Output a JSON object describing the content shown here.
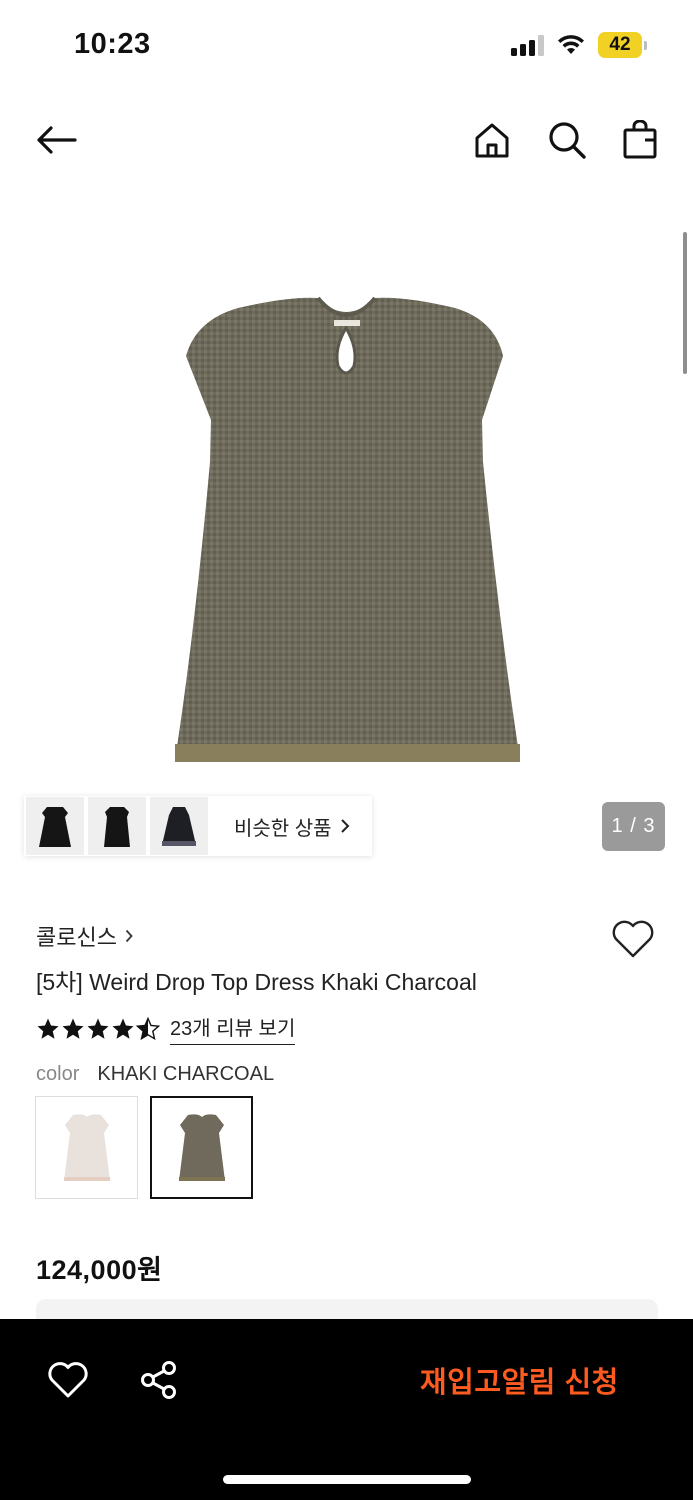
{
  "status_bar": {
    "time": "10:23",
    "battery": "42",
    "icons": [
      "signal-icon",
      "wifi-icon",
      "battery-icon"
    ]
  },
  "nav": {
    "icons": [
      "back-arrow-icon",
      "home-icon",
      "search-icon",
      "shopping-bag-icon"
    ]
  },
  "gallery": {
    "similar_label": "비슷한 상품",
    "pager": "1 / 3",
    "thumbnails": [
      "black-dress-thumb-1",
      "black-dress-thumb-2",
      "black-dress-thumb-3"
    ]
  },
  "product": {
    "brand": "콜로신스",
    "title": "[5차] Weird Drop Top Dress Khaki Charcoal",
    "rating": 4.5,
    "review_link": "23개 리뷰 보기",
    "color_label": "color",
    "color_value": "KHAKI CHARCOAL",
    "swatches": [
      {
        "name": "ivory",
        "color": "#e9e2dc",
        "selected": false
      },
      {
        "name": "khaki-charcoal",
        "color": "#6f6a5b",
        "selected": true
      }
    ],
    "price": "124,000원"
  },
  "bottom_bar": {
    "restock_label": "재입고알림 신청",
    "accent_color": "#ff5a1f"
  }
}
